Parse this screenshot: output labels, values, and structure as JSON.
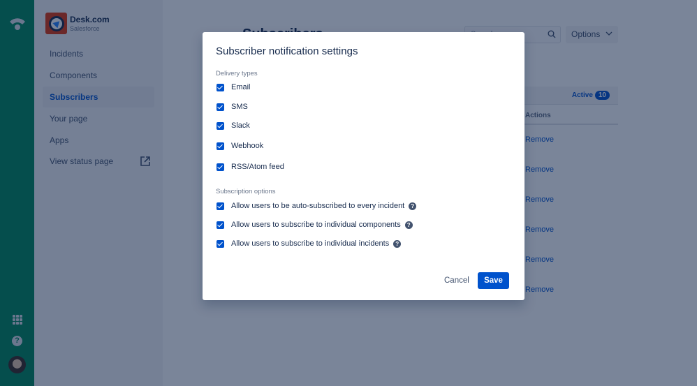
{
  "global_nav": {
    "icons": [
      "statuspage-logo-icon",
      "app-switcher-icon",
      "help-icon",
      "user-avatar"
    ],
    "help_glyph": "?"
  },
  "sidebar": {
    "project_name": "Desk.com",
    "project_org": "Salesforce",
    "items": [
      {
        "label": "Incidents"
      },
      {
        "label": "Components"
      },
      {
        "label": "Subscribers",
        "active": true
      },
      {
        "label": "Your page"
      },
      {
        "label": "Apps"
      },
      {
        "label": "View status page",
        "icon": "external-link-icon"
      }
    ]
  },
  "main": {
    "title": "Subscribers",
    "search_placeholder": "Search",
    "options_label": "Options",
    "tab_active_label": "Active",
    "tab_active_count": "10",
    "actions_header": "Actions",
    "remove_label": "Remove",
    "rows": 6
  },
  "modal": {
    "title": "Subscriber notification settings",
    "delivery_label": "Delivery types",
    "delivery_types": [
      {
        "label": "Email",
        "checked": true
      },
      {
        "label": "SMS",
        "checked": true
      },
      {
        "label": "Slack",
        "checked": true
      },
      {
        "label": "Webhook",
        "checked": true
      },
      {
        "label": "RSS/Atom feed",
        "checked": true
      }
    ],
    "subscription_label": "Subscription options",
    "subscription_options": [
      {
        "label": "Allow users to be auto-subscribed to every incident",
        "checked": true
      },
      {
        "label": "Allow users to subscribe to individual components",
        "checked": true
      },
      {
        "label": "Allow users to subscribe to individual incidents",
        "checked": true
      }
    ],
    "help_glyph": "?",
    "cancel_label": "Cancel",
    "save_label": "Save"
  },
  "colors": {
    "brand_green": "#00875a",
    "primary_blue": "#0052cc",
    "text_dark": "#172b4d"
  }
}
